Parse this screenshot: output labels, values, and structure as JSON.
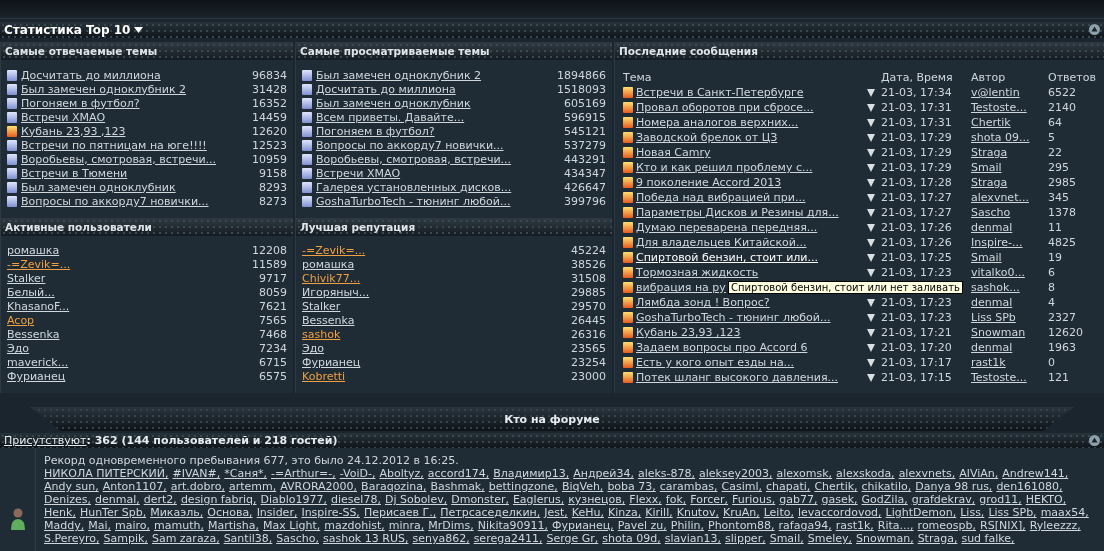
{
  "stats": {
    "title": "Статистика Top 10",
    "most_replied": {
      "title": "Самые отвечаемые темы",
      "rows": [
        {
          "title": "Досчитать до миллиона",
          "count": "96834",
          "hot": false
        },
        {
          "title": "Был замечен одноклубник 2",
          "count": "31428",
          "hot": false
        },
        {
          "title": "Погоняем в футбол?",
          "count": "16352",
          "hot": false
        },
        {
          "title": "Встречи ХМАО",
          "count": "14459",
          "hot": false
        },
        {
          "title": "Кубань 23,93 ,123",
          "count": "12620",
          "hot": true
        },
        {
          "title": "Встречи по пятницам на юге!!!!",
          "count": "12523",
          "hot": false
        },
        {
          "title": "Воробьевы, смотровая, встречи...",
          "count": "10959",
          "hot": false
        },
        {
          "title": "Встречи в Тюмени",
          "count": "9158",
          "hot": false
        },
        {
          "title": "Был замечен одноклубник",
          "count": "8293",
          "hot": false
        },
        {
          "title": "Вопросы по аккорду7 новички...",
          "count": "8273",
          "hot": false
        }
      ]
    },
    "most_viewed": {
      "title": "Самые просматриваемые темы",
      "rows": [
        {
          "title": "Был замечен одноклубник 2",
          "count": "1894866",
          "hot": false
        },
        {
          "title": "Досчитать до миллиона",
          "count": "1518093",
          "hot": false
        },
        {
          "title": "Был замечен одноклубник",
          "count": "605169",
          "hot": false
        },
        {
          "title": "Всем приветы. Давайте...",
          "count": "596915",
          "hot": false
        },
        {
          "title": "Погоняем в футбол?",
          "count": "545121",
          "hot": false
        },
        {
          "title": "Вопросы по аккорду7 новички...",
          "count": "537279",
          "hot": false
        },
        {
          "title": "Воробьевы, смотровая, встречи...",
          "count": "443291",
          "hot": false
        },
        {
          "title": "Встречи ХМАО",
          "count": "434347",
          "hot": false
        },
        {
          "title": "Галерея установленных дисков...",
          "count": "426647",
          "hot": false
        },
        {
          "title": "GoshaTurboTech - тюнинг любой...",
          "count": "399796",
          "hot": false
        }
      ]
    },
    "active_users": {
      "title": "Активные пользователи",
      "rows": [
        {
          "name": "ромашка",
          "count": "12208",
          "color": "#d0d8de"
        },
        {
          "name": "-=Zevik=...",
          "count": "11589",
          "color": "#f0a040"
        },
        {
          "name": "Stalker",
          "count": "9717",
          "color": "#d0d8de"
        },
        {
          "name": "Белый...",
          "count": "8059",
          "color": "#d0d8de"
        },
        {
          "name": "KhasanoF...",
          "count": "7621",
          "color": "#d0d8de"
        },
        {
          "name": "Acop",
          "count": "7565",
          "color": "#f0a040"
        },
        {
          "name": "Bessenka",
          "count": "7468",
          "color": "#d0d8de"
        },
        {
          "name": "Эдо",
          "count": "7234",
          "color": "#d0d8de"
        },
        {
          "name": "maverick...",
          "count": "6715",
          "color": "#d0d8de"
        },
        {
          "name": "Фурианец",
          "count": "6575",
          "color": "#d0d8de"
        }
      ]
    },
    "best_reputation": {
      "title": "Лучшая репутация",
      "rows": [
        {
          "name": "-=Zevik=...",
          "count": "45224",
          "color": "#f0a040"
        },
        {
          "name": "ромашка",
          "count": "38526",
          "color": "#d0d8de"
        },
        {
          "name": "Chivik77...",
          "count": "31508",
          "color": "#f0a040"
        },
        {
          "name": "Игоряныч...",
          "count": "29885",
          "color": "#d0d8de"
        },
        {
          "name": "Stalker",
          "count": "29570",
          "color": "#d0d8de"
        },
        {
          "name": "Bessenka",
          "count": "26445",
          "color": "#d0d8de"
        },
        {
          "name": "sashok",
          "count": "26316",
          "color": "#f0a040"
        },
        {
          "name": "Эдо",
          "count": "23565",
          "color": "#d0d8de"
        },
        {
          "name": "Фурианец",
          "count": "23254",
          "color": "#d0d8de"
        },
        {
          "name": "Kobretti",
          "count": "23000",
          "color": "#f0a040"
        }
      ]
    },
    "recent": {
      "title": "Последние сообщения",
      "columns": [
        "Тема",
        "Дата, Время",
        "Автор",
        "Ответов"
      ],
      "tooltip": "Спиртовой бензин, стоит или нет заливать",
      "rows": [
        {
          "title": "Встречи в Санкт-Петербурге",
          "date": "21-03, 17:34",
          "author": "v@lentin",
          "replies": "6522",
          "hovered": false
        },
        {
          "title": "Провал оборотов при сбросе...",
          "date": "21-03, 17:31",
          "author": "Testoste...",
          "replies": "2140",
          "hovered": false
        },
        {
          "title": "Номера аналогов верхних...",
          "date": "21-03, 17:31",
          "author": "Chertik",
          "replies": "64",
          "hovered": false
        },
        {
          "title": "Заводской брелок от ЦЗ",
          "date": "21-03, 17:29",
          "author": "shota 09...",
          "replies": "5",
          "hovered": false
        },
        {
          "title": "Новая Camry",
          "date": "21-03, 17:29",
          "author": "Straga",
          "replies": "22",
          "hovered": false
        },
        {
          "title": "Кто и как решил проблему с...",
          "date": "21-03, 17:29",
          "author": "Smail",
          "replies": "295",
          "hovered": false
        },
        {
          "title": "9 поколение Accord 2013",
          "date": "21-03, 17:28",
          "author": "Straga",
          "replies": "2985",
          "hovered": false
        },
        {
          "title": "Победа над вибрацией при...",
          "date": "21-03, 17:27",
          "author": "alexvnet...",
          "replies": "345",
          "hovered": false
        },
        {
          "title": "Параметры Дисков и Резины для...",
          "date": "21-03, 17:27",
          "author": "Sascho",
          "replies": "1378",
          "hovered": false
        },
        {
          "title": "Думаю переварена передняя...",
          "date": "21-03, 17:26",
          "author": "denmal",
          "replies": "11",
          "hovered": false
        },
        {
          "title": "Для владельцев Китайской...",
          "date": "21-03, 17:26",
          "author": "Inspire-...",
          "replies": "4825",
          "hovered": false
        },
        {
          "title": "Спиртовой бензин, стоит или...",
          "date": "21-03, 17:25",
          "author": "Smail",
          "replies": "19",
          "hovered": true
        },
        {
          "title": "Тормозная жидкость",
          "date": "21-03, 17:23",
          "author": "vitalko0...",
          "replies": "6",
          "hovered": false
        },
        {
          "title": "вибрация на ру",
          "author": "sashok...",
          "replies": "8",
          "hovered": false
        },
        {
          "title": "Лямбда зонд ! Вопрос?",
          "date": "21-03, 17:23",
          "author": "denmal",
          "replies": "4",
          "hovered": false
        },
        {
          "title": "GoshaTurboTech - тюнинг любой...",
          "date": "21-03, 17:23",
          "author": "Liss SPb",
          "replies": "2327",
          "hovered": false
        },
        {
          "title": "Кубань 23,93 ,123",
          "date": "21-03, 17:21",
          "author": "Snowman",
          "replies": "12620",
          "hovered": false
        },
        {
          "title": "Задаем вопросы про Accord 6",
          "date": "21-03, 17:20",
          "author": "denmal",
          "replies": "1963",
          "hovered": false
        },
        {
          "title": "Есть у кого опыт езды на...",
          "date": "21-03, 17:17",
          "author": "rast1k",
          "replies": "0",
          "hovered": false
        },
        {
          "title": "Потек шланг высокого давления...",
          "date": "21-03, 17:15",
          "author": "Testoste...",
          "replies": "121",
          "hovered": false
        }
      ]
    }
  },
  "online": {
    "heading": "Кто на форуме",
    "label": "Присутствуют",
    "summary": ": 362 (144 пользователей и 218 гостей)",
    "record": "Рекорд одновременного пребывания 677, это было 24.12.2012 в 16:25.",
    "lines": [
      [
        "НИКОЛА ПИТЕРСКИЙ,",
        "#IVAN#,",
        "*Саня*,",
        "-=Arthur=-,",
        "-VoiD-,",
        "Aboltyz,",
        "accord174,",
        "Владимир13,",
        "Андрей34,",
        "aleks-878,",
        "aleksey2003,",
        "alexomsk,",
        "alexskoda,",
        "alexvnets,",
        "AlViAn,",
        "Andrew141,"
      ],
      [
        "Andy sun,",
        "Anton1107,",
        "art.dobro,",
        "artemm,",
        "AVRORA2000,",
        "Baraqozina,",
        "Bashmak,",
        "bettingzone,",
        "BiqVeh,",
        "boba 73,",
        "carambas,",
        "Casiml,",
        "chapati,",
        "Chertik,",
        "chikatilo,",
        "Danya 98 rus,",
        "den161080,"
      ],
      [
        "Denizes,",
        "denmal,",
        "dert2,",
        "design fabriq,",
        "Diablo1977,",
        "diesel78,",
        "Dj Sobolev,",
        "Dmonster,",
        "Eaglerus,",
        "кузнецов,",
        "Flexx,",
        "fok,",
        "Forcer,",
        "Furious,",
        "gab77,",
        "gasek,",
        "GodZila,",
        "grafdekrav,",
        "grod11,",
        "HEKTO,"
      ],
      [
        "Henk,",
        "HunTer Spb,",
        "Микаэль,",
        "Основа,",
        "Insider,",
        "Inspire-SS,",
        "Перисаев Г.,",
        "Петрсаседелкин,",
        "Jest,",
        "KeHu,",
        "Kinza,",
        "Kirill,",
        "Knutov,",
        "KruAn,",
        "Leito,",
        "levaccordovod,",
        "LightDemon,",
        "Liss,",
        "Liss SPb,",
        "maax54,"
      ],
      [
        "Maddy,",
        "Mai,",
        "mairo,",
        "mamuth,",
        "Martisha,",
        "Max Light,",
        "mazdohist,",
        "minra,",
        "MrDims,",
        "Nikita90911,",
        "Фурианец,",
        "Pavel zu,",
        "Philin,",
        "Phontom88,",
        "rafaga94,",
        "rast1k,",
        "Rita...,",
        "romeospb,",
        "RS[NIX],",
        "Ryleezzz,"
      ],
      [
        "S.Pereyro,",
        "Sampik,",
        "Sam zaraza,",
        "Santil38,",
        "Sascho,",
        "sashok 13 RUS,",
        "senya862,",
        "serega2411,",
        "Serge Gr,",
        "shota 09d,",
        "slavian13,",
        "slipper,",
        "Smail,",
        "Smeley,",
        "Snowman,",
        "Straga,",
        "sud falke,"
      ]
    ]
  }
}
